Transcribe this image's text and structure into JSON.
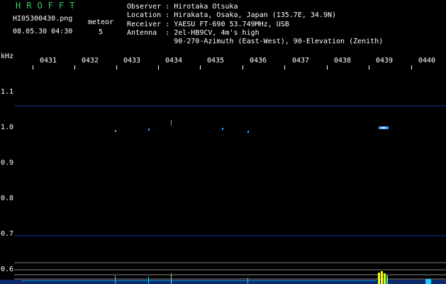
{
  "header": {
    "brand": "HROFFT",
    "filename": "HI05300430.png",
    "datetime": "08.05.30 04:30",
    "meteor_label": "meteor",
    "meteor_count": "5"
  },
  "station": {
    "observer": "Observer : Hirotaka Otsuka",
    "location": "Location : Hirakata, Osaka, Japan (135.7E, 34.9N)",
    "receiver": "Receiver : YAESU FT-690 53.749MHz, USB",
    "antenna": "Antenna  : 2el-HB9CV, 4m's high",
    "antenna_detail": "           90-270-Azimuth (East-West), 90-Elevation (Zenith)"
  },
  "axis": {
    "y_unit": "kHz",
    "x_ticks": [
      "0431",
      "0432",
      "0433",
      "0434",
      "0435",
      "0436",
      "0437",
      "0438",
      "0439",
      "0440"
    ],
    "y_ticks": [
      "1.1",
      "1.0",
      "0.9",
      "0.8",
      "0.7",
      "0.6"
    ]
  },
  "colors": {
    "background": "#000000",
    "brand": "#34d067",
    "text": "#ffffff",
    "grid_blue": "#1a2fb0",
    "grid_gray": "#8a8a8a",
    "echo": "#3aa0ff",
    "echo_strong": "#ffff00"
  }
}
